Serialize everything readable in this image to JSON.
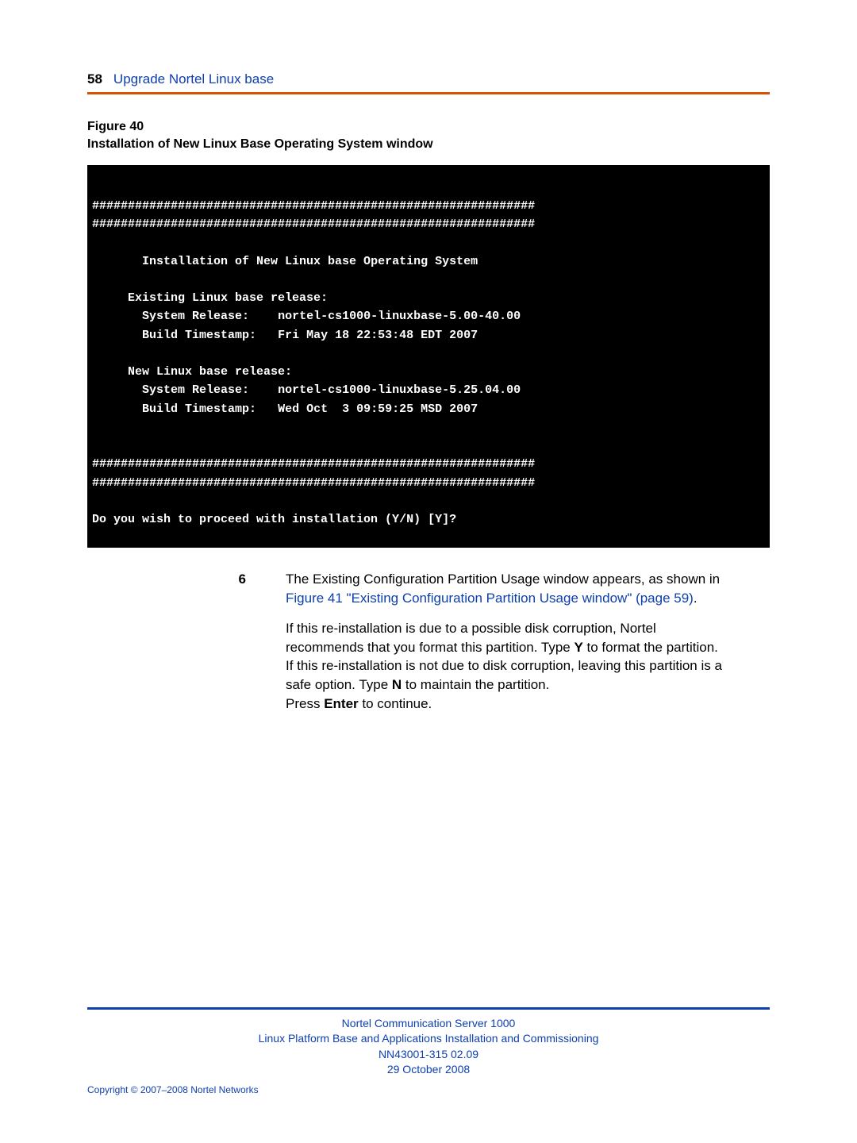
{
  "header": {
    "page_number": "58",
    "section": "Upgrade Nortel Linux base"
  },
  "figure": {
    "label": "Figure 40",
    "caption": "Installation of New Linux Base Operating System window"
  },
  "terminal": {
    "hashline": "##############################################################",
    "title": "Installation of New Linux base Operating System",
    "existing_heading": "Existing Linux base release:",
    "sysrel_label": "System Release:",
    "build_label": "Build Timestamp:",
    "existing_sysrel": "nortel-cs1000-linuxbase-5.00-40.00",
    "existing_build": "Fri May 18 22:53:48 EDT 2007",
    "new_heading": "New Linux base release:",
    "new_sysrel": "nortel-cs1000-linuxbase-5.25.04.00",
    "new_build": "Wed Oct  3 09:59:25 MSD 2007",
    "prompt": "Do you wish to proceed with installation (Y/N) [Y]?"
  },
  "step": {
    "number": "6",
    "p1_a": "The Existing Configuration Partition Usage window appears, as shown in ",
    "p1_link": "Figure 41 \"Existing Configuration Partition Usage window\" (page 59)",
    "p1_b": ".",
    "p2_a": "If this re-installation is due to a possible disk corruption, Nortel recommends that you format this partition. Type ",
    "p2_bold1": "Y",
    "p2_b": " to format the partition.",
    "p3_a": "If this re-installation is not due to disk corruption, leaving this partition is a safe option. Type ",
    "p3_bold1": "N",
    "p3_b": " to maintain the partition.",
    "p4_a": "Press ",
    "p4_bold1": "Enter",
    "p4_b": " to continue."
  },
  "footer": {
    "line1": "Nortel Communication Server 1000",
    "line2": "Linux Platform Base and Applications Installation and Commissioning",
    "line3": "NN43001-315   02.09",
    "line4": "29 October 2008",
    "copyright": "Copyright © 2007–2008 Nortel Networks"
  }
}
